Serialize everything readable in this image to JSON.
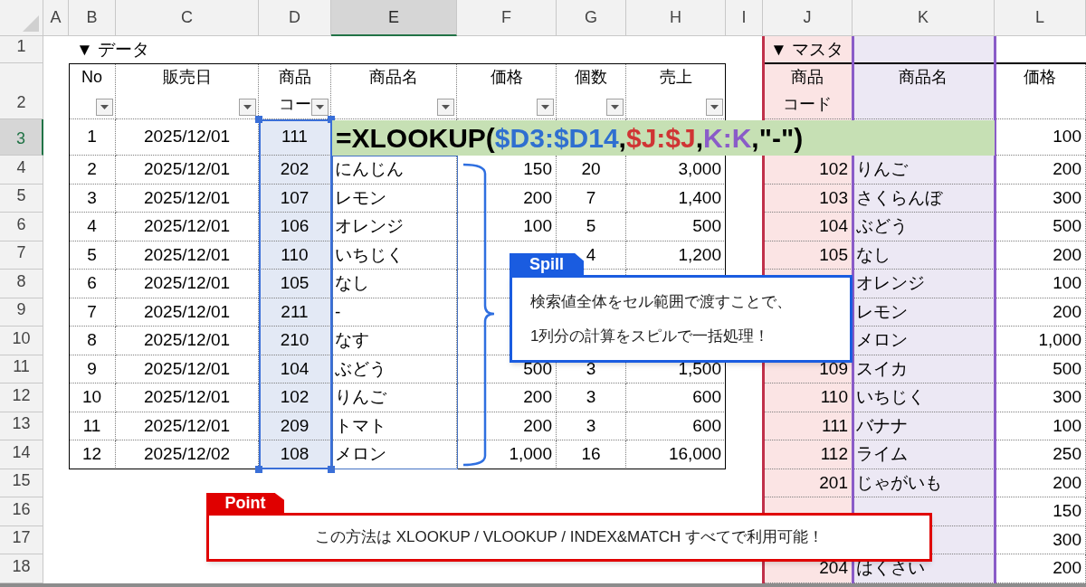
{
  "sheet": {
    "columns": [
      {
        "label": "A",
        "selected": false
      },
      {
        "label": "B",
        "selected": false
      },
      {
        "label": "C",
        "selected": false
      },
      {
        "label": "D",
        "selected": false
      },
      {
        "label": "E",
        "selected": true
      },
      {
        "label": "F",
        "selected": false
      },
      {
        "label": "G",
        "selected": false
      },
      {
        "label": "H",
        "selected": false
      },
      {
        "label": "I",
        "selected": false
      },
      {
        "label": "J",
        "selected": false
      },
      {
        "label": "K",
        "selected": false
      },
      {
        "label": "L",
        "selected": false
      }
    ],
    "rows": [
      {
        "label": "1",
        "selected": false
      },
      {
        "label": "2",
        "selected": false
      },
      {
        "label": "3",
        "selected": true
      },
      {
        "label": "4",
        "selected": false
      },
      {
        "label": "5",
        "selected": false
      },
      {
        "label": "6",
        "selected": false
      },
      {
        "label": "7",
        "selected": false
      },
      {
        "label": "8",
        "selected": false
      },
      {
        "label": "9",
        "selected": false
      },
      {
        "label": "10",
        "selected": false
      },
      {
        "label": "11",
        "selected": false
      },
      {
        "label": "12",
        "selected": false
      },
      {
        "label": "13",
        "selected": false
      },
      {
        "label": "14",
        "selected": false
      },
      {
        "label": "15",
        "selected": false
      },
      {
        "label": "16",
        "selected": false
      },
      {
        "label": "17",
        "selected": false
      },
      {
        "label": "18",
        "selected": false
      }
    ]
  },
  "data_table": {
    "title": "▼ データ",
    "headers": [
      {
        "lines": [
          "No"
        ],
        "filter": true
      },
      {
        "lines": [
          "販売日"
        ],
        "filter": true
      },
      {
        "lines": [
          "商品",
          "コー"
        ],
        "filter": true
      },
      {
        "lines": [
          "商品名"
        ],
        "filter": true
      },
      {
        "lines": [
          "価格"
        ],
        "filter": true
      },
      {
        "lines": [
          "個数"
        ],
        "filter": true
      },
      {
        "lines": [
          "売上"
        ],
        "filter": true
      }
    ],
    "rows": [
      {
        "no": "1",
        "date": "2025/12/01",
        "code": "111"
      },
      {
        "no": "2",
        "date": "2025/12/01",
        "code": "202",
        "name": "にんじん",
        "price": "150",
        "qty": "20",
        "sales": "3,000"
      },
      {
        "no": "3",
        "date": "2025/12/01",
        "code": "107",
        "name": "レモン",
        "price": "200",
        "qty": "7",
        "sales": "1,400"
      },
      {
        "no": "4",
        "date": "2025/12/01",
        "code": "106",
        "name": "オレンジ",
        "price": "100",
        "qty": "5",
        "sales": "500"
      },
      {
        "no": "5",
        "date": "2025/12/01",
        "code": "110",
        "name": "いちじく",
        "qty": "4",
        "sales": "1,200"
      },
      {
        "no": "6",
        "date": "2025/12/01",
        "code": "105",
        "name": "なし"
      },
      {
        "no": "7",
        "date": "2025/12/01",
        "code": "211",
        "name": "-"
      },
      {
        "no": "8",
        "date": "2025/12/01",
        "code": "210",
        "name": "なす"
      },
      {
        "no": "9",
        "date": "2025/12/01",
        "code": "104",
        "name": "ぶどう",
        "price": "500",
        "qty": "3",
        "sales": "1,500"
      },
      {
        "no": "10",
        "date": "2025/12/01",
        "code": "102",
        "name": "りんご",
        "price": "200",
        "qty": "3",
        "sales": "600"
      },
      {
        "no": "11",
        "date": "2025/12/01",
        "code": "209",
        "name": "トマト",
        "price": "200",
        "qty": "3",
        "sales": "600"
      },
      {
        "no": "12",
        "date": "2025/12/02",
        "code": "108",
        "name": "メロン",
        "price": "1,000",
        "qty": "16",
        "sales": "16,000"
      }
    ]
  },
  "master_table": {
    "title": "▼ マスタ",
    "headers": [
      {
        "lines": [
          "商品",
          "コード"
        ],
        "filter": false
      },
      {
        "lines": [
          "商品名"
        ],
        "filter": false
      },
      {
        "lines": [
          "価格"
        ],
        "filter": false
      }
    ],
    "rows": [
      {
        "price": "100"
      },
      {
        "code": "102",
        "name": "りんご",
        "price": "200"
      },
      {
        "code": "103",
        "name": "さくらんぼ",
        "price": "300"
      },
      {
        "code": "104",
        "name": "ぶどう",
        "price": "500"
      },
      {
        "code": "105",
        "name": "なし",
        "price": "200"
      },
      {
        "name": "オレンジ",
        "price": "100"
      },
      {
        "name": "レモン",
        "price": "200"
      },
      {
        "name": "メロン",
        "price": "1,000"
      },
      {
        "code": "109",
        "name": "スイカ",
        "price": "500"
      },
      {
        "code": "110",
        "name": "いちじく",
        "price": "300"
      },
      {
        "code": "111",
        "name": "バナナ",
        "price": "100"
      },
      {
        "code": "112",
        "name": "ライム",
        "price": "250"
      },
      {
        "code": "201",
        "name": "じゃがいも",
        "price": "200"
      },
      {
        "price": "150"
      },
      {
        "price": "300"
      },
      {
        "code": "204",
        "name": "はくさい",
        "price": "200"
      }
    ]
  },
  "formula": {
    "segments": [
      {
        "text": "=XLOOKUP(",
        "color": "#000000"
      },
      {
        "text": "$D3:$D14",
        "color": "#2f6fd0"
      },
      {
        "text": ",",
        "color": "#000000"
      },
      {
        "text": "$J:$J",
        "color": "#d03434"
      },
      {
        "text": ",",
        "color": "#000000"
      },
      {
        "text": "K:K",
        "color": "#8a5cc8"
      },
      {
        "text": ",\"-\")",
        "color": "#000000"
      }
    ]
  },
  "spill_callout": {
    "tag": "Spill",
    "lines": [
      "検索値全体をセル範囲で渡すことで、",
      "1列分の計算をスピルで一括処理！"
    ]
  },
  "point_callout": {
    "tag": "Point",
    "text": "この方法は XLOOKUP / VLOOKUP / INDEX&MATCH すべてで利用可能！"
  }
}
